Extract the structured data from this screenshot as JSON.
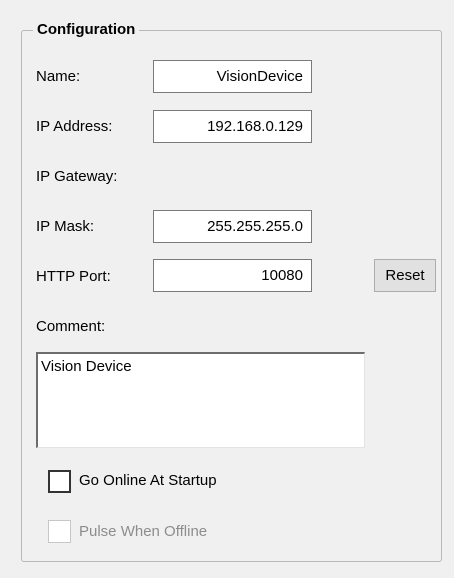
{
  "group": {
    "title": "Configuration"
  },
  "fields": {
    "name": {
      "label": "Name:",
      "value": "VisionDevice"
    },
    "ip_address": {
      "label": "IP Address:",
      "value": "192.168.0.129"
    },
    "ip_gateway": {
      "label": "IP Gateway:"
    },
    "ip_mask": {
      "label": "IP Mask:",
      "value": "255.255.255.0"
    },
    "http_port": {
      "label": "HTTP Port:",
      "value": "10080"
    }
  },
  "reset_label": "Reset",
  "comment": {
    "label": "Comment:",
    "value": "Vision Device"
  },
  "checkboxes": {
    "go_online": {
      "label": "Go Online At Startup",
      "checked": false,
      "enabled": true
    },
    "pulse_offline": {
      "label": "Pulse When Offline",
      "checked": false,
      "enabled": false
    }
  }
}
